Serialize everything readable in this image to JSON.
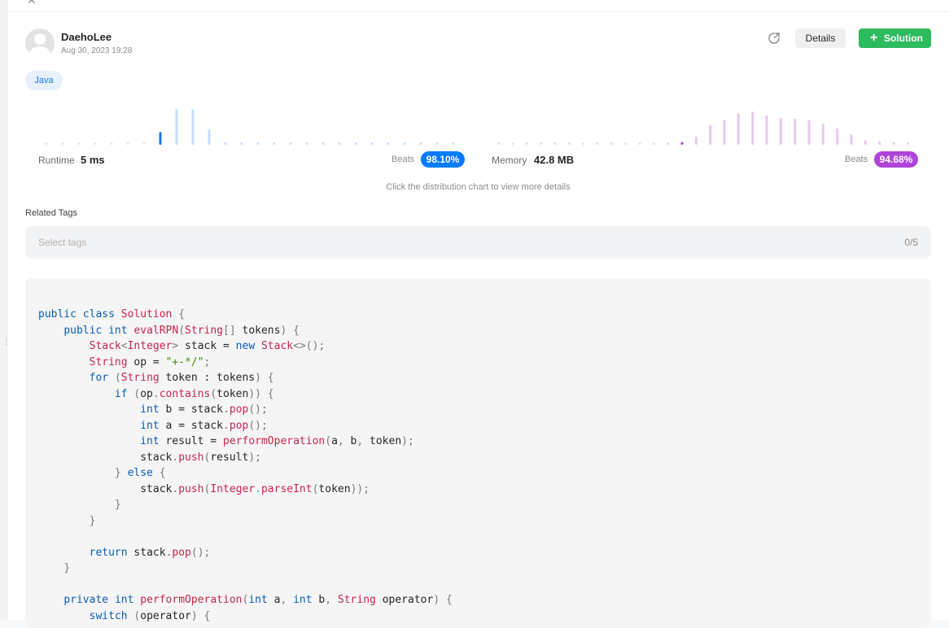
{
  "header": {
    "username": "DaehoLee",
    "timestamp": "Aug 30, 2023 19:28",
    "details_label": "Details",
    "solution_label": "Solution"
  },
  "language_tag": "Java",
  "stats": {
    "runtime_label": "Runtime",
    "runtime_value": "5 ms",
    "runtime_beats_label": "Beats",
    "runtime_beats": "98.10%",
    "memory_label": "Memory",
    "memory_value": "42.8 MB",
    "memory_beats_label": "Beats",
    "memory_beats": "94.68%"
  },
  "chart_hint": "Click the distribution chart to view more details",
  "related_tags": {
    "title": "Related Tags",
    "placeholder": "Select tags",
    "count": "0/5"
  },
  "colors": {
    "accent_blue": "#007aff",
    "accent_purple": "#b044d9",
    "solution_green": "#2cbb5d"
  },
  "icons": [
    "close-icon",
    "avatar-icon",
    "share-icon",
    "plus-icon"
  ],
  "chart_data": [
    {
      "type": "bar",
      "metric": "runtime",
      "values": [
        0.03,
        0.03,
        0.03,
        0.03,
        0.03,
        0.03,
        0.03,
        0.36,
        1.0,
        1.0,
        0.44,
        0.06,
        0.05,
        0.05,
        0.05,
        0.05,
        0.05,
        0.05,
        0.05,
        0.05,
        0.05,
        0.05,
        0.05,
        0.05,
        0.05,
        0.05
      ],
      "highlight_index": 7,
      "color_bar": "#c7defc",
      "color_dot": "#d6e6fb",
      "color_highlight": "#1a73e8"
    },
    {
      "type": "bar",
      "metric": "memory",
      "values": [
        0.03,
        0.03,
        0.03,
        0.03,
        0.03,
        0.03,
        0.03,
        0.03,
        0.03,
        0.03,
        0.03,
        0.03,
        0.03,
        0.08,
        0.23,
        0.55,
        0.7,
        0.88,
        0.93,
        0.83,
        0.76,
        0.73,
        0.69,
        0.6,
        0.46,
        0.29,
        0.13,
        0.1,
        0.08,
        0.06
      ],
      "highlight_index": 13,
      "color_bar": "#e7c9f1",
      "color_dot": "#ecd8f3",
      "color_highlight": "#b044d9"
    }
  ],
  "code": {
    "language": "java",
    "lines": [
      "public class Solution {",
      "    public int evalRPN(String[] tokens) {",
      "        Stack<Integer> stack = new Stack<>();",
      "        String op = \"+-*/\";",
      "        for (String token : tokens) {",
      "            if (op.contains(token)) {",
      "                int b = stack.pop();",
      "                int a = stack.pop();",
      "                int result = performOperation(a, b, token);",
      "                stack.push(result);",
      "            } else {",
      "                stack.push(Integer.parseInt(token));",
      "            }",
      "        }",
      "",
      "        return stack.pop();",
      "    }",
      "",
      "    private int performOperation(int a, int b, String operator) {",
      "        switch (operator) {"
    ]
  }
}
